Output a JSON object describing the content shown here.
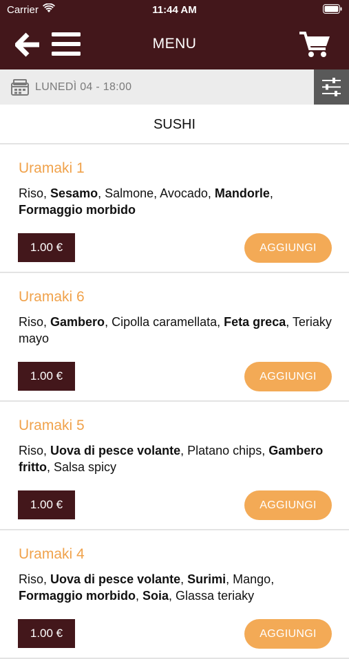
{
  "status_bar": {
    "carrier": "Carrier",
    "time": "11:44 AM"
  },
  "nav": {
    "title": "MENU",
    "back_icon": "back-arrow-icon",
    "menu_icon": "hamburger-icon",
    "cart_icon": "cart-icon"
  },
  "date_bar": {
    "text": "LUNEDÌ 04 - 18:00",
    "icon": "calendar-icon",
    "filter_icon": "sliders-icon"
  },
  "section": {
    "title": "SUSHI"
  },
  "colors": {
    "brand": "#43171b",
    "accent": "#f3aa56",
    "item_title": "#f0a24b",
    "date_bar_bg": "#ececec",
    "filter_bg": "#595959"
  },
  "items": [
    {
      "name": "Uramaki 1",
      "ingredients": [
        {
          "text": "Riso",
          "bold": false
        },
        {
          "text": "Sesamo",
          "bold": true
        },
        {
          "text": "Salmone",
          "bold": false
        },
        {
          "text": "Avocado",
          "bold": false
        },
        {
          "text": "Mandorle",
          "bold": true
        },
        {
          "text": "Formaggio morbido",
          "bold": true
        }
      ],
      "price": "1.00 €",
      "add_label": "AGGIUNGI"
    },
    {
      "name": "Uramaki 6",
      "ingredients": [
        {
          "text": "Riso",
          "bold": false
        },
        {
          "text": "Gambero",
          "bold": true
        },
        {
          "text": "Cipolla caramellata",
          "bold": false
        },
        {
          "text": "Feta greca",
          "bold": true
        },
        {
          "text": "Teriaky mayo",
          "bold": false
        }
      ],
      "price": "1.00 €",
      "add_label": "AGGIUNGI"
    },
    {
      "name": "Uramaki 5",
      "ingredients": [
        {
          "text": "Riso",
          "bold": false
        },
        {
          "text": "Uova di pesce volante",
          "bold": true
        },
        {
          "text": "Platano chips",
          "bold": false
        },
        {
          "text": "Gambero fritto",
          "bold": true
        },
        {
          "text": "Salsa spicy",
          "bold": false
        }
      ],
      "price": "1.00 €",
      "add_label": "AGGIUNGI"
    },
    {
      "name": "Uramaki 4",
      "ingredients": [
        {
          "text": "Riso",
          "bold": false
        },
        {
          "text": "Uova di pesce volante",
          "bold": true
        },
        {
          "text": "Surimi",
          "bold": true
        },
        {
          "text": "Mango",
          "bold": false
        },
        {
          "text": "Formaggio morbido",
          "bold": true
        },
        {
          "text": "Soia",
          "bold": true
        },
        {
          "text": "Glassa teriaky",
          "bold": false
        }
      ],
      "price": "1.00 €",
      "add_label": "AGGIUNGI"
    }
  ]
}
